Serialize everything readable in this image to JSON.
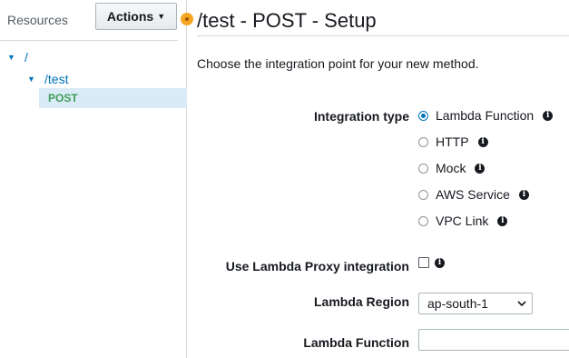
{
  "sidebar": {
    "title": "Resources",
    "actions_label": "Actions",
    "tree": [
      {
        "label": "/"
      },
      {
        "label": "/test"
      }
    ],
    "selected_method": "POST"
  },
  "main": {
    "title": "/test - POST - Setup",
    "intro": "Choose the integration point for your new method.",
    "integration_type_label": "Integration type",
    "integration_options": [
      {
        "label": "Lambda Function",
        "checked": true
      },
      {
        "label": "HTTP",
        "checked": false
      },
      {
        "label": "Mock",
        "checked": false
      },
      {
        "label": "AWS Service",
        "checked": false
      },
      {
        "label": "VPC Link",
        "checked": false
      }
    ],
    "proxy_label": "Use Lambda Proxy integration",
    "proxy_checked": false,
    "region_label": "Lambda Region",
    "region_value": "ap-south-1",
    "function_label": "Lambda Function",
    "function_value": ""
  },
  "icons": {
    "info": "info-icon",
    "caret": "caret-down-icon",
    "tree_toggle": "triangle-down-icon"
  },
  "colors": {
    "link": "#0073bb",
    "method": "#3f9e57",
    "selected_bg": "#d9ebf7",
    "title_dot": "#f6a623"
  }
}
